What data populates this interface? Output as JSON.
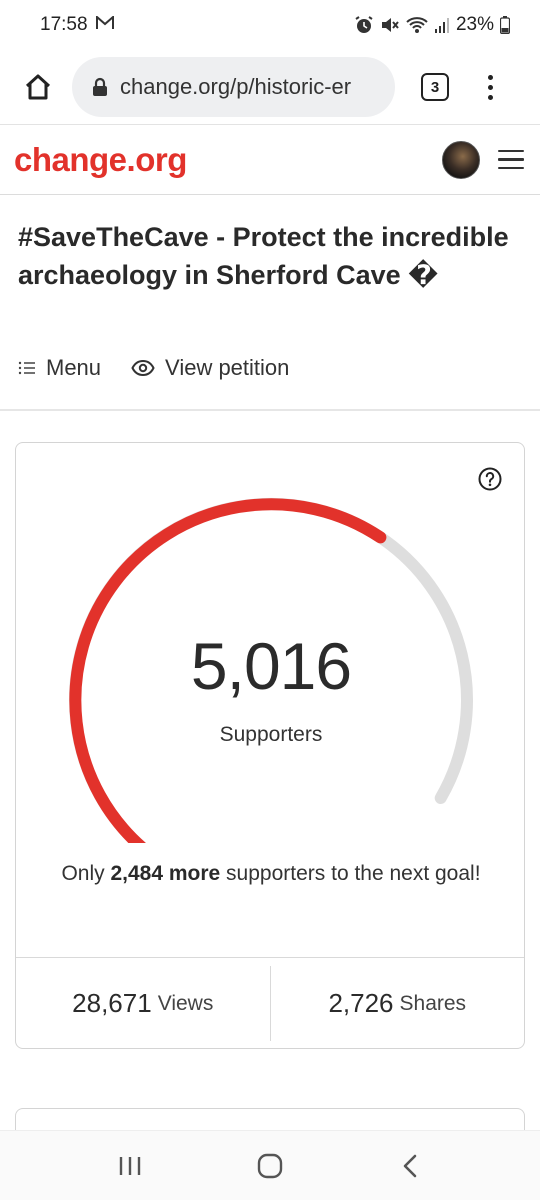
{
  "status": {
    "time": "17:58",
    "battery": "23%",
    "icons": [
      "gmail-icon",
      "alarm-icon",
      "mute-icon",
      "wifi-icon",
      "signal-icon",
      "battery-icon"
    ]
  },
  "browser": {
    "url": "change.org/p/historic-er",
    "tab_count": "3"
  },
  "site": {
    "logo": "change.org"
  },
  "petition": {
    "title": "#SaveTheCave - Protect the incredible archaeology in Sherford Cave �",
    "menu_label": "Menu",
    "view_label": "View petition"
  },
  "progress": {
    "supporters": "5,016",
    "supporters_label": "Supporters",
    "goal_prefix": "Only ",
    "goal_highlight": "2,484 more",
    "goal_suffix": " supporters to the next goal!",
    "fraction": 0.669,
    "accent_color": "#e2322b",
    "track_color": "#dedede"
  },
  "stats": {
    "views_count": "28,671",
    "views_label": "Views",
    "shares_count": "2,726",
    "shares_label": "Shares"
  }
}
